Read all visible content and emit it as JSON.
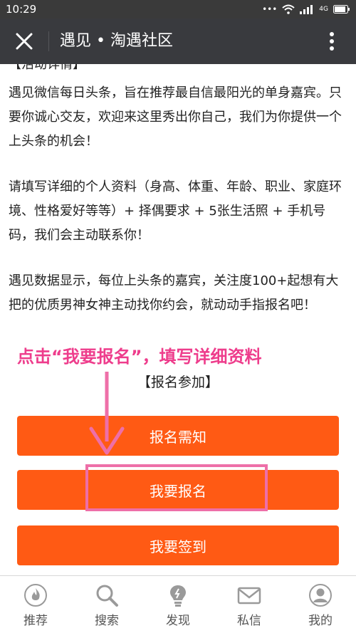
{
  "status_bar": {
    "time": "10:29",
    "network": "4G"
  },
  "nav": {
    "title": "遇见 • 淘遇社区"
  },
  "article": {
    "heading_partial": "【活动详情】",
    "paragraphs": [
      "遇见微信每日头条，旨在推荐最自信最阳光的单身嘉宾。只要你诚心交友，欢迎来这里秀出你自己，我们为你提供一个上头条的机会！",
      "请填写详细的个人资料（身高、体重、年龄、职业、家庭环境、性格爱好等等）+ 择偶要求 + 5张生活照 + 手机号码，我们会主动联系你！",
      "遇见数据显示，每位上头条的嘉宾，关注度100+起想有大把的优质男神女神主动找你约会，就动动手指报名吧！"
    ]
  },
  "annotation": {
    "text": "点击“我要报名”，填写详细资料"
  },
  "signup": {
    "title": "【报名参加】",
    "buttons": [
      "报名需知",
      "我要报名",
      "我要签到"
    ]
  },
  "tabs": [
    {
      "label": "推荐",
      "icon": "flame-icon"
    },
    {
      "label": "搜索",
      "icon": "search-icon"
    },
    {
      "label": "发现",
      "icon": "lightbulb-icon"
    },
    {
      "label": "私信",
      "icon": "mail-icon"
    },
    {
      "label": "我的",
      "icon": "user-icon"
    }
  ],
  "colors": {
    "accent_button": "#ff5a14",
    "annotation_pink": "#ee3d8c",
    "navbar": "#393a3e"
  }
}
